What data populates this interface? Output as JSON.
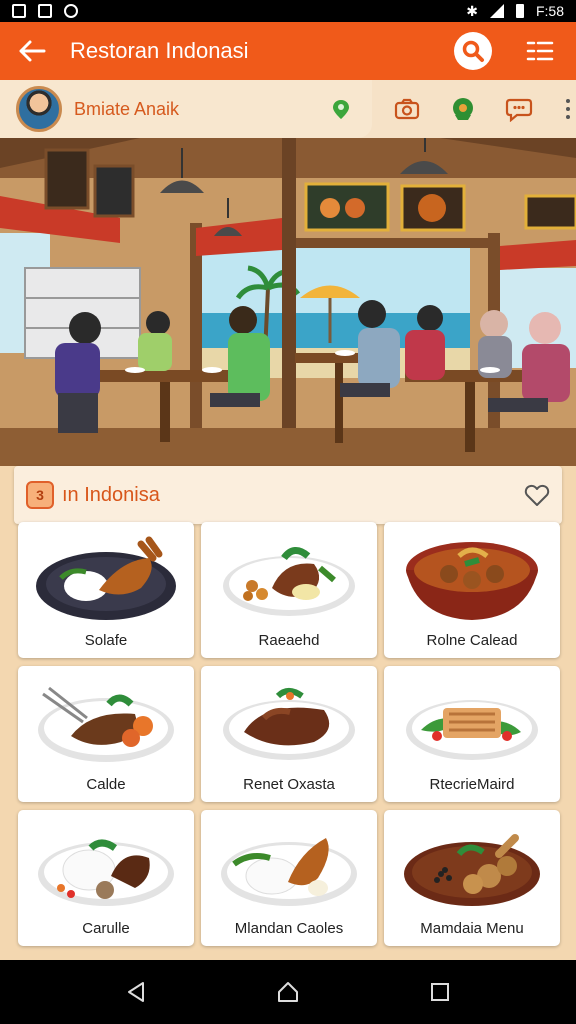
{
  "status_bar": {
    "time": "F:58"
  },
  "app_bar": {
    "title": "Restoran Indonasi"
  },
  "profile": {
    "name": "Bmiate Anaik"
  },
  "section": {
    "badge": "3",
    "title": "ın Indonisa"
  },
  "menu_items": [
    {
      "label": "Solafe",
      "plate": "#2b2b3a"
    },
    {
      "label": "Raeaehd",
      "plate": "#ffffff"
    },
    {
      "label": "Rolne Calead",
      "plate": "#9b2d1d"
    },
    {
      "label": "Calde",
      "plate": "#ffffff"
    },
    {
      "label": "Renet Oxasta",
      "plate": "#ffffff"
    },
    {
      "label": "RtecrieMaird",
      "plate": "#ffffff"
    },
    {
      "label": "Carulle",
      "plate": "#ffffff"
    },
    {
      "label": "Mlandan Caoles",
      "plate": "#ffffff"
    },
    {
      "label": "Mamdaia Menu",
      "plate": "#6b2a16"
    }
  ],
  "colors": {
    "accent": "#f05a1a",
    "header_bg": "#f8e7cf",
    "page_bg": "#f3d7b0"
  }
}
